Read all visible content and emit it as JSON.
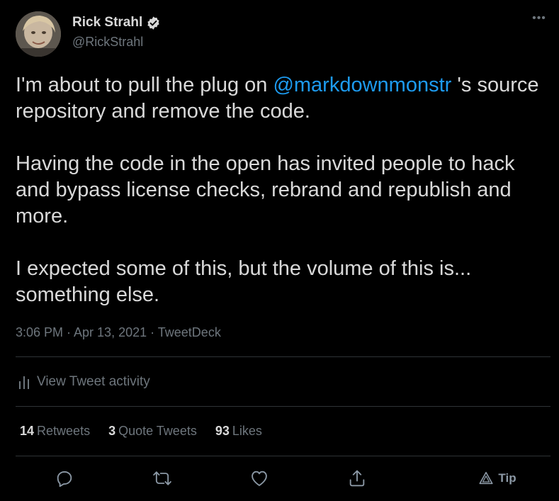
{
  "author": {
    "display_name": "Rick Strahl",
    "handle": "@RickStrahl"
  },
  "tweet": {
    "mention": "@markdownmonstr",
    "p1_before": "I'm about to pull the plug on ",
    "p1_after": " 's source repository and remove the code.",
    "p2": "Having the code in the open has invited people to hack and bypass license checks, rebrand and republish and more.",
    "p3": "I expected some of this, but the volume of this is... something else.",
    "meta": "3:06 PM · Apr 13, 2021 · TweetDeck"
  },
  "activity": {
    "label": "View Tweet activity"
  },
  "stats": {
    "retweets_count": "14",
    "retweets_label": "Retweets",
    "quotes_count": "3",
    "quotes_label": "Quote Tweets",
    "likes_count": "93",
    "likes_label": "Likes"
  },
  "actions": {
    "tip_label": "Tip",
    "icons": [
      "reply-icon",
      "retweet-icon",
      "like-icon",
      "share-icon",
      "tip-icon"
    ]
  },
  "colors": {
    "background": "#000000",
    "text": "#d9d9d9",
    "muted": "#6e767d",
    "link": "#1d9bf0",
    "divider": "#2f3336",
    "verified": "#d9d9d9"
  }
}
